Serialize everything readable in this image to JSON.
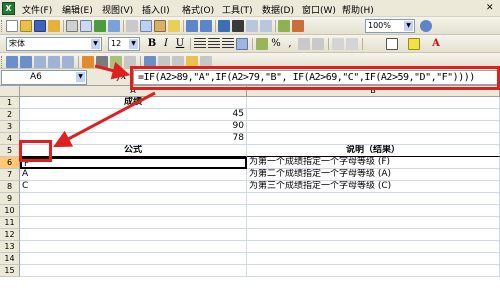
{
  "menubar": {
    "items": [
      "文件(F)",
      "编辑(E)",
      "视图(V)",
      "插入(I)",
      "格式(O)",
      "工具(T)",
      "数据(D)",
      "窗口(W)",
      "帮助(H)"
    ],
    "app_icon": "excel-icon"
  },
  "toolbar1": {
    "zoom": "100%"
  },
  "toolbar2": {
    "font": "宋体",
    "size": "12"
  },
  "formulabar": {
    "cell_ref": "A6",
    "fx": "fx",
    "formula": "=IF(A2>89,\"A\",IF(A2>79,\"B\", IF(A2>69,\"C\",IF(A2>59,\"D\",\"F\"))))"
  },
  "grid": {
    "columns": [
      "A",
      "B"
    ],
    "rows": [
      "1",
      "2",
      "3",
      "4",
      "5",
      "6",
      "7",
      "8",
      "9",
      "10",
      "11",
      "12",
      "13",
      "14",
      "15"
    ],
    "cells": {
      "A1": "成绩",
      "A2": "45",
      "A3": "90",
      "A4": "78",
      "A5": "公式",
      "B5": "说明（结果）",
      "A6": "F",
      "B6": "为第一个成绩指定一个字母等级 (F)",
      "A7": "A",
      "B7": "为第二个成绩指定一个字母等级 (A)",
      "A8": "C",
      "B8": "为第三个成绩指定一个字母等级 (C)"
    }
  },
  "colors": {
    "annotation": "#e02020",
    "chrome": "#ece9d8",
    "active_row": "#ffc973"
  }
}
